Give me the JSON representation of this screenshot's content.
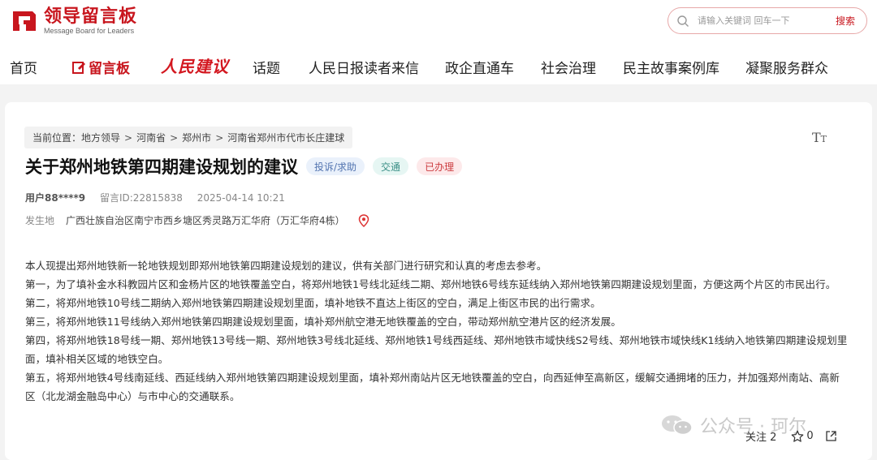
{
  "brand": {
    "title": "领导留言板",
    "subtitle": "Message Board for Leaders",
    "red": "#c8161e"
  },
  "search": {
    "placeholder": "请输入关键词 回车一下",
    "button": "搜索"
  },
  "nav": {
    "items": [
      "首页",
      "留言板",
      "人民建议",
      "话题",
      "人民日报读者来信",
      "政企直通车",
      "社会治理",
      "民主故事案例库",
      "凝聚服务群众"
    ],
    "active": "留言板"
  },
  "breadcrumb": {
    "prefix": "当前位置：",
    "items": [
      "地方领导",
      "河南省",
      "郑州市",
      "河南省郑州市代市长庄建球"
    ]
  },
  "post": {
    "title": "关于郑州地铁第四期建设规划的建议",
    "tags": [
      "投诉/求助",
      "交通",
      "已办理"
    ],
    "user": "用户88****9",
    "id": "留言ID:22815838",
    "time": "2025-04-14 10:21",
    "location_label": "发生地",
    "location": "广西壮族自治区南宁市西乡塘区秀灵路万汇华府（万汇华府4栋）",
    "paragraphs": [
      "本人现提出郑州地铁新一轮地铁规划即郑州地铁第四期建设规划的建议，供有关部门进行研究和认真的考虑去参考。",
      "第一，为了填补金水科教园片区和金杨片区的地铁覆盖空白，将郑州地铁1号线北延线二期、郑州地铁6号线东延线纳入郑州地铁第四期建设规划里面，方便这两个片区的市民出行。",
      "第二，将郑州地铁10号线二期纳入郑州地铁第四期建设规划里面，填补地铁不直达上街区的空白，满足上街区市民的出行需求。",
      "第三，将郑州地铁11号线纳入郑州地铁第四期建设规划里面，填补郑州航空港无地铁覆盖的空白，带动郑州航空港片区的经济发展。",
      "第四，将郑州地铁18号线一期、郑州地铁13号线一期、郑州地铁3号线北延线、郑州地铁1号线西延线、郑州地铁市域快线S2号线、郑州地铁市域快线K1线纳入地铁第四期建设规划里面，填补相关区域的地铁空白。",
      "第五，将郑州地铁4号线南延线、西延线纳入郑州地铁第四期建设规划里面，填补郑州南站片区无地铁覆盖的空白，向西延伸至高新区，缓解交通拥堵的压力，并加强郑州南站、高新区（北龙湖金融岛中心）与市中心的交通联系。"
    ]
  },
  "footer": {
    "follow": "关注 2",
    "likes": "0"
  },
  "watermark": "公众号 · 珂尔"
}
